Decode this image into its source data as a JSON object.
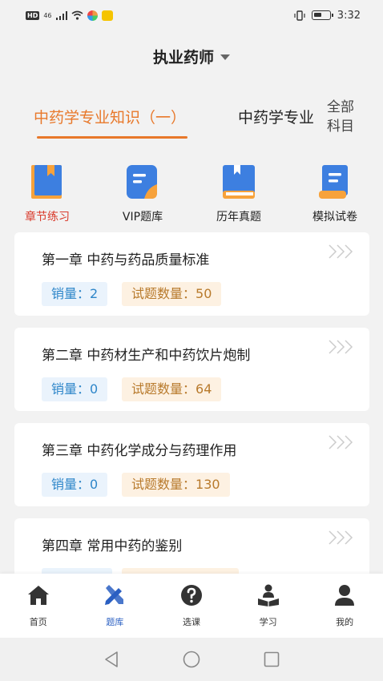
{
  "status": {
    "hd": "HD",
    "net": "46",
    "time": "3:32"
  },
  "header": {
    "title": "执业药师"
  },
  "tabs": [
    {
      "label": "中药学专业知识（一）",
      "active": true
    },
    {
      "label": "中药学专业"
    }
  ],
  "all_subjects": {
    "line1": "全部",
    "line2": "科目"
  },
  "categories": [
    {
      "label": "章节练习",
      "icon": "chapter-practice-icon",
      "active": true
    },
    {
      "label": "VIP题库",
      "icon": "vip-bank-icon"
    },
    {
      "label": "历年真题",
      "icon": "past-exams-icon"
    },
    {
      "label": "模拟试卷",
      "icon": "mock-paper-icon"
    }
  ],
  "chapters": [
    {
      "title": "第一章 中药与药品质量标准",
      "sales_label": "销量：",
      "sales": "2",
      "count_label": "试题数量：",
      "count": "50"
    },
    {
      "title": "第二章 中药材生产和中药饮片炮制",
      "sales_label": "销量：",
      "sales": "0",
      "count_label": "试题数量：",
      "count": "64"
    },
    {
      "title": "第三章 中药化学成分与药理作用",
      "sales_label": "销量：",
      "sales": "0",
      "count_label": "试题数量：",
      "count": "130"
    },
    {
      "title": "第四章 常用中药的鉴别",
      "sales_label": "",
      "sales": "",
      "count_label": "",
      "count": ""
    }
  ],
  "bottom_nav": [
    {
      "label": "首页",
      "icon": "home-icon"
    },
    {
      "label": "题库",
      "icon": "question-bank-icon",
      "active": true
    },
    {
      "label": "选课",
      "icon": "help-circle-icon"
    },
    {
      "label": "学习",
      "icon": "study-icon"
    },
    {
      "label": "我的",
      "icon": "profile-icon"
    }
  ],
  "colors": {
    "accent": "#e8782a",
    "active_category": "#d93a2b",
    "nav_active": "#2a5fc2",
    "sales_tag_bg": "#eaf3fc",
    "sales_tag_text": "#2e86c9",
    "count_tag_bg": "#fdf1e2",
    "count_tag_text": "#b87a2c"
  }
}
